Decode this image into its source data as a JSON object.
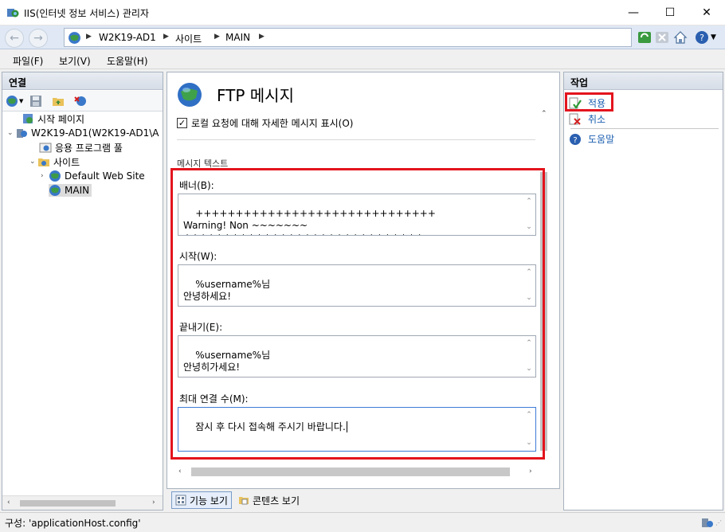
{
  "window": {
    "title": "IIS(인터넷 정보 서비스) 관리자",
    "min_glyph": "—",
    "max_glyph": "☐",
    "close_glyph": "✕"
  },
  "address": {
    "crumbs": [
      "W2K19-AD1",
      "사이트",
      "MAIN"
    ]
  },
  "menu": [
    "파일(F)",
    "보기(V)",
    "도움말(H)"
  ],
  "connections": {
    "title": "연결",
    "tree": [
      {
        "label": "시작 페이지",
        "level": 0
      },
      {
        "label": "W2K19-AD1(W2K19-AD1\\A",
        "level": 0
      },
      {
        "label": "응용 프로그램 풀",
        "level": 1
      },
      {
        "label": "사이트",
        "level": 1
      },
      {
        "label": "Default Web Site",
        "level": 2
      },
      {
        "label": "MAIN",
        "level": 2
      }
    ]
  },
  "center": {
    "title": "FTP 메시지",
    "checkbox_label": "로컬 요청에 대해 자세한 메시지 표시(O)",
    "checkbox_checked": true,
    "group_label": "메시지 텍스트",
    "fields": [
      {
        "label": "배너(B):",
        "value": "++++++++++++++++++++++++++++++\nWarning! Non ~~~~~~~\n++++++++++++++++++++++++++++++"
      },
      {
        "label": "시작(W):",
        "value": "%username%님\n안녕하세요!"
      },
      {
        "label": "끝내기(E):",
        "value": "%username%님\n안녕히가세요!"
      },
      {
        "label": "최대 연결 수(M):",
        "value": "잠시 후 다시 접속해 주시기 바랍니다."
      }
    ]
  },
  "view_tabs": [
    "기능 보기",
    "콘텐츠 보기"
  ],
  "actions": {
    "title": "작업",
    "items": [
      "적용",
      "취소",
      "도움말"
    ]
  },
  "status": {
    "text": "구성: 'applicationHost.config'"
  },
  "colors": {
    "highlight": "#e3141d",
    "link": "#1c5fb1"
  }
}
